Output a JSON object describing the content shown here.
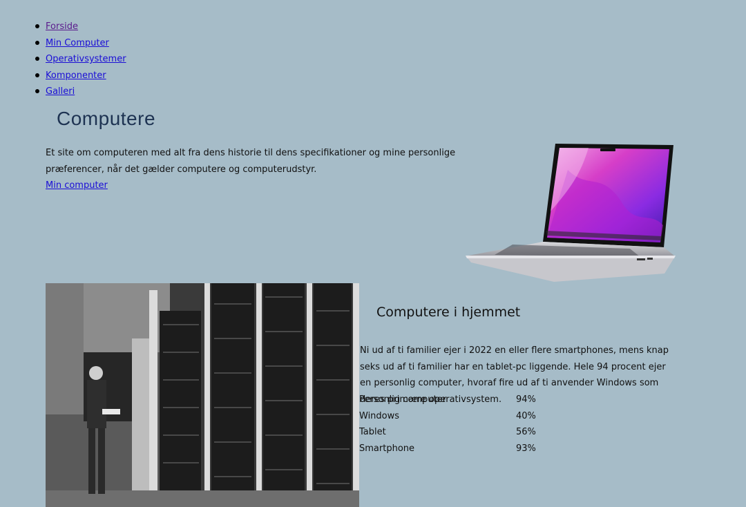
{
  "nav": {
    "items": [
      {
        "label": "Forside"
      },
      {
        "label": "Min Computer"
      },
      {
        "label": "Operativsystemer"
      },
      {
        "label": "Komponenter"
      },
      {
        "label": "Galleri"
      }
    ]
  },
  "header": {
    "title": "Computere",
    "intro": "Et site om computeren med alt fra dens historie til dens specifikationer og mine personlige præferencer, når det gælder computere og computerudstyr.",
    "link": "Min computer"
  },
  "section": {
    "heading": "Computere i hjemmet",
    "body": "Ni ud af ti familier ejer i 2022 en eller flere smartphones, mens knap seks ud af ti familier har en tablet-pc liggende. Hele 94 procent ejer en personlig computer, hvoraf fire ud af ti anvender Windows som deres primære operativsystem.",
    "stats": [
      {
        "label": "Personlig computer",
        "value": "94%"
      },
      {
        "label": "Windows",
        "value": "40%"
      },
      {
        "label": "Tablet",
        "value": "56%"
      },
      {
        "label": "Smartphone",
        "value": "93%"
      }
    ]
  },
  "colors": {
    "background": "#a6bcc8",
    "title": "#1e3352",
    "link": "#1a0dd6",
    "visited_link": "#5a1a8c"
  }
}
